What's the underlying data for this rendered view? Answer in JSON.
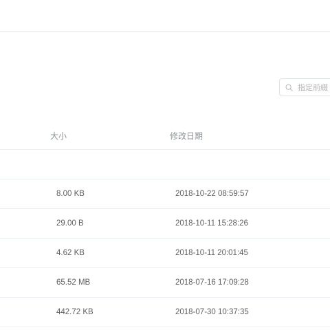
{
  "search": {
    "placeholder": "指定前綴"
  },
  "table": {
    "columns": {
      "size": "大小",
      "modified": "修改日期"
    },
    "rows": [
      {
        "size": "",
        "modified": ""
      },
      {
        "size": "8.00 KB",
        "modified": "2018-10-22 08:59:57"
      },
      {
        "size": "29.00 B",
        "modified": "2018-10-11 15:28:26"
      },
      {
        "size": "4.62 KB",
        "modified": "2018-10-11 20:01:45"
      },
      {
        "size": "65.52 MB",
        "modified": "2018-07-16 17:09:28"
      },
      {
        "size": "442.72 KB",
        "modified": "2018-07-30 10:37:35"
      }
    ]
  },
  "colors": {
    "divider": "#ebeef5",
    "header_text": "#909399",
    "cell_text": "#5f5f5f",
    "input_border": "#dcdfe6"
  },
  "icons": {
    "search": "search-icon"
  }
}
